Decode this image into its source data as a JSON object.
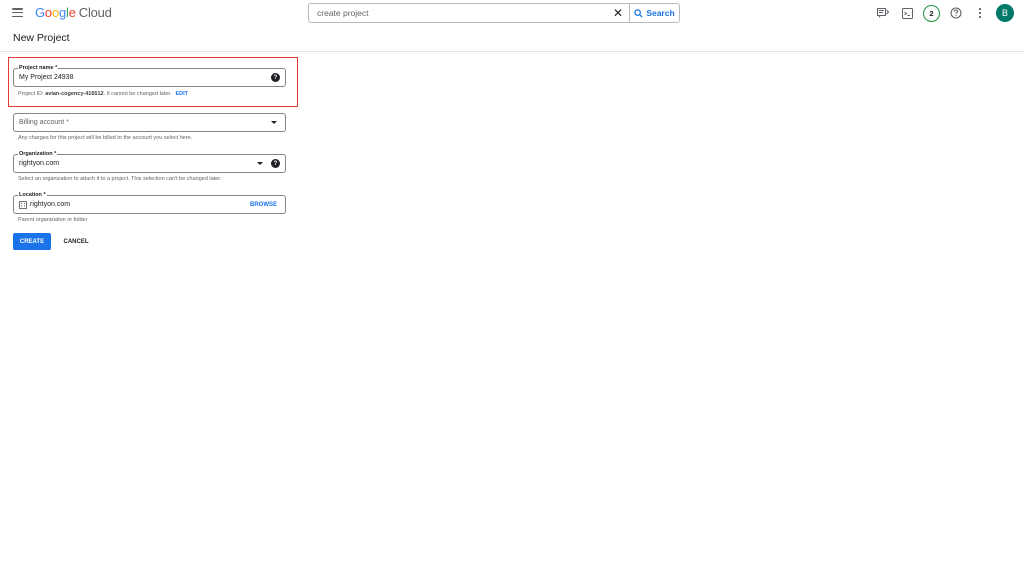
{
  "app": {
    "logo_letters": [
      "G",
      "o",
      "o",
      "g",
      "l",
      "e"
    ],
    "logo_suffix": "Cloud"
  },
  "search": {
    "value": "create project",
    "button_label": "Search"
  },
  "topbar": {
    "notification_count": "2",
    "avatar_initial": "B"
  },
  "page": {
    "title": "New Project"
  },
  "form": {
    "project_name": {
      "label": "Project name *",
      "value": "My Project 24938",
      "hint_prefix": "Project ID: ",
      "project_id": "avian-cogency-416512",
      "hint_suffix": ". It cannot be changed later.",
      "edit_label": "EDIT"
    },
    "billing": {
      "placeholder": "Billing account *",
      "hint": "Any charges for this project will be billed to the account you select here."
    },
    "organization": {
      "label": "Organization *",
      "value": "rightyon.com",
      "hint": "Select an organization to attach it to a project. This selection can't be changed later."
    },
    "location": {
      "label": "Location *",
      "value": "rightyon.com",
      "browse_label": "BROWSE",
      "hint": "Parent organization or folder"
    },
    "create_label": "CREATE",
    "cancel_label": "CANCEL"
  },
  "colors": {
    "primary": "#1a73e8",
    "highlight": "#e53935",
    "avatar": "#00796b",
    "badge_ring": "#1e8e3e"
  }
}
